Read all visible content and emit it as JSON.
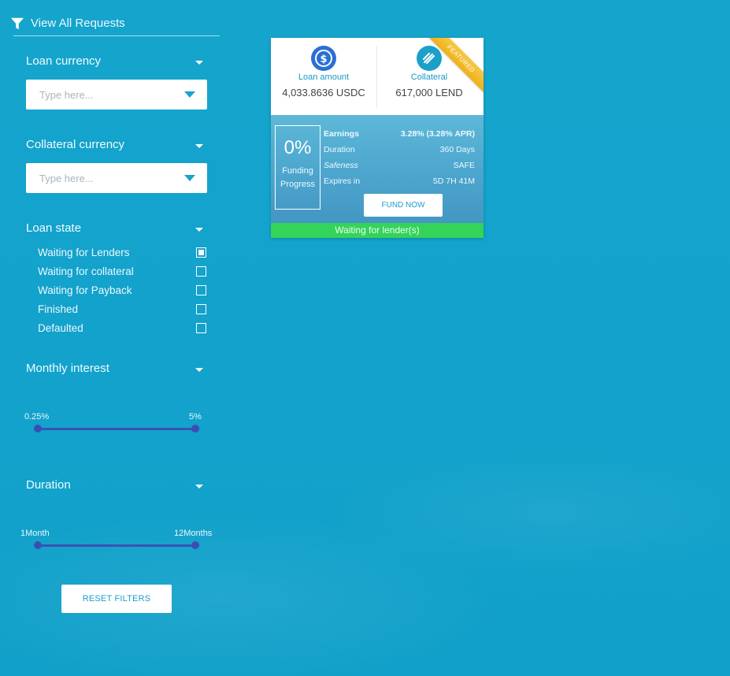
{
  "sidebar": {
    "view_all": "View All Requests",
    "loan_currency": {
      "label": "Loan currency",
      "placeholder": "Type here..."
    },
    "collateral_currency": {
      "label": "Collateral currency",
      "placeholder": "Type here..."
    },
    "loan_state": {
      "label": "Loan state",
      "options": [
        {
          "label": "Waiting for Lenders",
          "checked": true
        },
        {
          "label": "Waiting for collateral",
          "checked": false
        },
        {
          "label": "Waiting for Payback",
          "checked": false
        },
        {
          "label": "Finished",
          "checked": false
        },
        {
          "label": "Defaulted",
          "checked": false
        }
      ]
    },
    "monthly_interest": {
      "label": "Monthly interest",
      "min_label": "0.25%",
      "max_label": "5%",
      "min_value": 0.25,
      "max_value": 5,
      "range_min": 0.25,
      "range_max": 5
    },
    "duration": {
      "label": "Duration",
      "min_label": "1Month",
      "max_label": "12Months",
      "min_value": 1,
      "max_value": 12,
      "range_min": 1,
      "range_max": 12
    },
    "reset_label": "RESET FILTERS"
  },
  "card": {
    "ribbon": "FEATURED",
    "loan": {
      "caption": "Loan amount",
      "amount": "4,033.8636 USDC"
    },
    "collateral": {
      "caption": "Collateral",
      "amount": "617,000 LEND"
    },
    "progress": {
      "value": "0%",
      "label_line1": "Funding",
      "label_line2": "Progress"
    },
    "stats": [
      {
        "key": "Earnings",
        "value": "3.28% (3.28% APR)"
      },
      {
        "key": "Duration",
        "value": "360 Days"
      },
      {
        "key": "Safeness",
        "value": "SAFE"
      },
      {
        "key": "Expires in",
        "value": "5D 7H 41M"
      }
    ],
    "fund_label": "FUND NOW",
    "status": "Waiting for lender(s)"
  },
  "colors": {
    "background": "#14a4cc",
    "accent": "#1b9fc9",
    "slider": "#3a52b5",
    "status_green": "#34d35a",
    "ribbon": "#f3bb2e"
  },
  "icons": {
    "filter": "filter-icon",
    "usdc": "usdc-coin-icon",
    "lend": "lend-coin-icon"
  }
}
